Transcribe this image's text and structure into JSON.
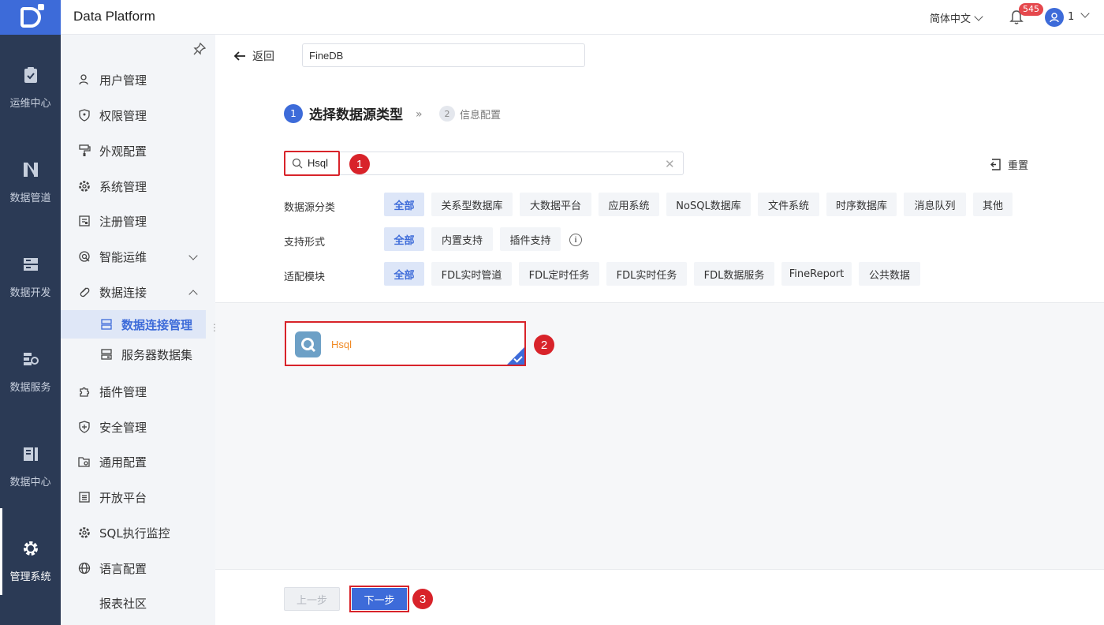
{
  "header": {
    "app_title": "Data Platform",
    "language": "简体中文",
    "notification_count": "545",
    "user_name": "1"
  },
  "rail": {
    "items": [
      {
        "label": "运维中心",
        "icon": "clipboard-check-icon"
      },
      {
        "label": "数据管道",
        "icon": "pipeline-icon"
      },
      {
        "label": "数据开发",
        "icon": "server-stack-icon"
      },
      {
        "label": "数据服务",
        "icon": "service-api-icon"
      },
      {
        "label": "数据中心",
        "icon": "data-center-icon"
      },
      {
        "label": "管理系统",
        "icon": "gear-icon",
        "active": true
      }
    ]
  },
  "sidebar": {
    "items": [
      {
        "label": "用户管理",
        "icon": "user-icon"
      },
      {
        "label": "权限管理",
        "icon": "shield-key-icon"
      },
      {
        "label": "外观配置",
        "icon": "paint-roller-icon"
      },
      {
        "label": "系统管理",
        "icon": "gear-icon"
      },
      {
        "label": "注册管理",
        "icon": "register-icon"
      },
      {
        "label": "智能运维",
        "icon": "monitor-icon"
      },
      {
        "label": "数据连接",
        "icon": "link-icon"
      },
      {
        "label": "数据连接管理",
        "icon": "db-connection-icon",
        "active": true
      },
      {
        "label": "服务器数据集",
        "icon": "server-dataset-icon"
      },
      {
        "label": "插件管理",
        "icon": "puzzle-icon"
      },
      {
        "label": "安全管理",
        "icon": "shield-plus-icon"
      },
      {
        "label": "通用配置",
        "icon": "folder-gear-icon"
      },
      {
        "label": "开放平台",
        "icon": "list-icon"
      },
      {
        "label": "SQL执行监控",
        "icon": "gear-icon"
      },
      {
        "label": "语言配置",
        "icon": "globe-icon"
      },
      {
        "label": "报表社区",
        "icon": ""
      }
    ]
  },
  "main": {
    "back_label": "返回",
    "connection_name": "FineDB",
    "steps": [
      {
        "num": "1",
        "label": "选择数据源类型"
      },
      {
        "num": "2",
        "label": "信息配置"
      }
    ],
    "search_value": "Hsql",
    "reset_label": "重置",
    "markers": [
      "1",
      "2",
      "3"
    ],
    "filters": [
      {
        "label": "数据源分类",
        "options": [
          "全部",
          "关系型数据库",
          "大数据平台",
          "应用系统",
          "NoSQL数据库",
          "文件系统",
          "时序数据库",
          "消息队列",
          "其他"
        ],
        "selected": "全部"
      },
      {
        "label": "支持形式",
        "options": [
          "全部",
          "内置支持",
          "插件支持"
        ],
        "selected": "全部"
      },
      {
        "label": "适配模块",
        "options": [
          "全部",
          "FDL实时管道",
          "FDL定时任务",
          "FDL实时任务",
          "FDL数据服务",
          "FineReport",
          "公共数据"
        ],
        "selected": "全部"
      }
    ],
    "result_card": {
      "label": "Hsql",
      "selected": true
    },
    "prev_label": "上一步",
    "next_label": "下一步"
  },
  "colors": {
    "accent": "#3d6bd9",
    "rail_bg": "#2b3a55",
    "highlight": "#d8232a",
    "card_label": "#f08a24"
  }
}
